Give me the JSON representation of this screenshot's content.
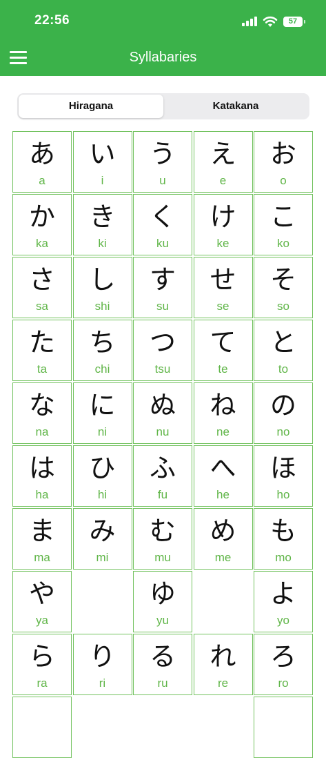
{
  "status_bar": {
    "time": "22:56",
    "battery": "57"
  },
  "header": {
    "title": "Syllabaries"
  },
  "tabs": [
    {
      "label": "Hiragana",
      "active": true
    },
    {
      "label": "Katakana",
      "active": false
    }
  ],
  "colors": {
    "primary": "#3bb24a",
    "cell_border": "#72c25e",
    "romaji": "#5fb547"
  },
  "icons": [
    "hamburger-menu-icon",
    "cellular-signal-icon",
    "wifi-icon",
    "battery-icon"
  ],
  "cells": [
    {
      "kana": "あ",
      "romaji": "a"
    },
    {
      "kana": "い",
      "romaji": "i"
    },
    {
      "kana": "う",
      "romaji": "u"
    },
    {
      "kana": "え",
      "romaji": "e"
    },
    {
      "kana": "お",
      "romaji": "o"
    },
    {
      "kana": "か",
      "romaji": "ka"
    },
    {
      "kana": "き",
      "romaji": "ki"
    },
    {
      "kana": "く",
      "romaji": "ku"
    },
    {
      "kana": "け",
      "romaji": "ke"
    },
    {
      "kana": "こ",
      "romaji": "ko"
    },
    {
      "kana": "さ",
      "romaji": "sa"
    },
    {
      "kana": "し",
      "romaji": "shi"
    },
    {
      "kana": "す",
      "romaji": "su"
    },
    {
      "kana": "せ",
      "romaji": "se"
    },
    {
      "kana": "そ",
      "romaji": "so"
    },
    {
      "kana": "た",
      "romaji": "ta"
    },
    {
      "kana": "ち",
      "romaji": "chi"
    },
    {
      "kana": "つ",
      "romaji": "tsu"
    },
    {
      "kana": "て",
      "romaji": "te"
    },
    {
      "kana": "と",
      "romaji": "to"
    },
    {
      "kana": "な",
      "romaji": "na"
    },
    {
      "kana": "に",
      "romaji": "ni"
    },
    {
      "kana": "ぬ",
      "romaji": "nu"
    },
    {
      "kana": "ね",
      "romaji": "ne"
    },
    {
      "kana": "の",
      "romaji": "no"
    },
    {
      "kana": "は",
      "romaji": "ha"
    },
    {
      "kana": "ひ",
      "romaji": "hi"
    },
    {
      "kana": "ふ",
      "romaji": "fu"
    },
    {
      "kana": "へ",
      "romaji": "he"
    },
    {
      "kana": "ほ",
      "romaji": "ho"
    },
    {
      "kana": "ま",
      "romaji": "ma"
    },
    {
      "kana": "み",
      "romaji": "mi"
    },
    {
      "kana": "む",
      "romaji": "mu"
    },
    {
      "kana": "め",
      "romaji": "me"
    },
    {
      "kana": "も",
      "romaji": "mo"
    },
    {
      "kana": "や",
      "romaji": "ya"
    },
    null,
    {
      "kana": "ゆ",
      "romaji": "yu"
    },
    null,
    {
      "kana": "よ",
      "romaji": "yo"
    },
    {
      "kana": "ら",
      "romaji": "ra"
    },
    {
      "kana": "り",
      "romaji": "ri"
    },
    {
      "kana": "る",
      "romaji": "ru"
    },
    {
      "kana": "れ",
      "romaji": "re"
    },
    {
      "kana": "ろ",
      "romaji": "ro"
    },
    {
      "kana": "",
      "romaji": ""
    },
    null,
    null,
    null,
    {
      "kana": "",
      "romaji": ""
    }
  ]
}
